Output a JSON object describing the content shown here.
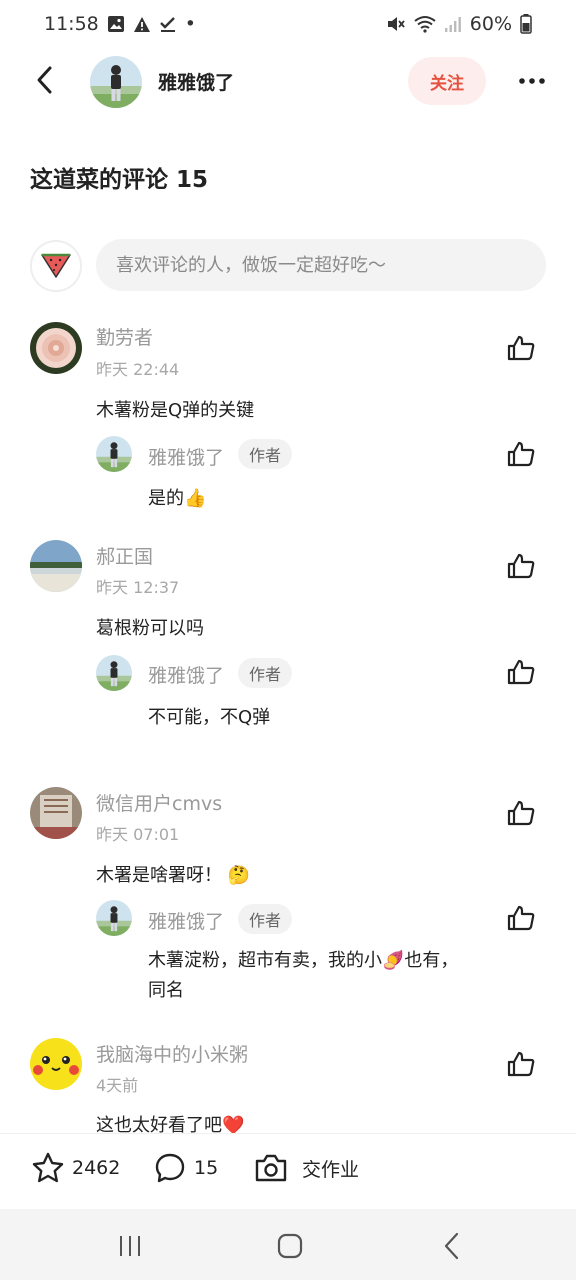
{
  "status_bar": {
    "time": "11:58",
    "battery": "60%",
    "dot": "•"
  },
  "header": {
    "author_name": "雅雅饿了",
    "follow_label": "关注"
  },
  "section": {
    "title": "这道菜的评论 15"
  },
  "comment_input": {
    "placeholder": "喜欢评论的人，做饭一定超好吃～"
  },
  "comments": [
    {
      "user": "勤劳者",
      "time": "昨天 22:44",
      "text": "木薯粉是Q弹的关键",
      "reply": {
        "user": "雅雅饿了",
        "badge": "作者",
        "text": "是的",
        "emoji": "👍"
      }
    },
    {
      "user": "郝正国",
      "time": "昨天 12:37",
      "text": "葛根粉可以吗",
      "reply": {
        "user": "雅雅饿了",
        "badge": "作者",
        "text": "不可能，不Q弹"
      }
    },
    {
      "user": "微信用户cmvs",
      "time": "昨天 07:01",
      "text": "木署是啥署呀！",
      "emoji": "🤔",
      "reply": {
        "user": "雅雅饿了",
        "badge": "作者",
        "text_line1": "木薯淀粉，超市有卖，我的小",
        "emoji": "🍠",
        "text_line1_end": "也有，",
        "text_line2": "同名"
      }
    },
    {
      "user": "我脑海中的小米粥",
      "time": "4天前",
      "text": "这也太好看了吧",
      "emoji": "❤️"
    }
  ],
  "bottom_bar": {
    "star_count": "2462",
    "comment_count": "15",
    "homework_label": "交作业"
  },
  "colors": {
    "accent": "#e5523f",
    "follow_bg": "#fdeeed",
    "muted_text": "#9a9a9a"
  }
}
